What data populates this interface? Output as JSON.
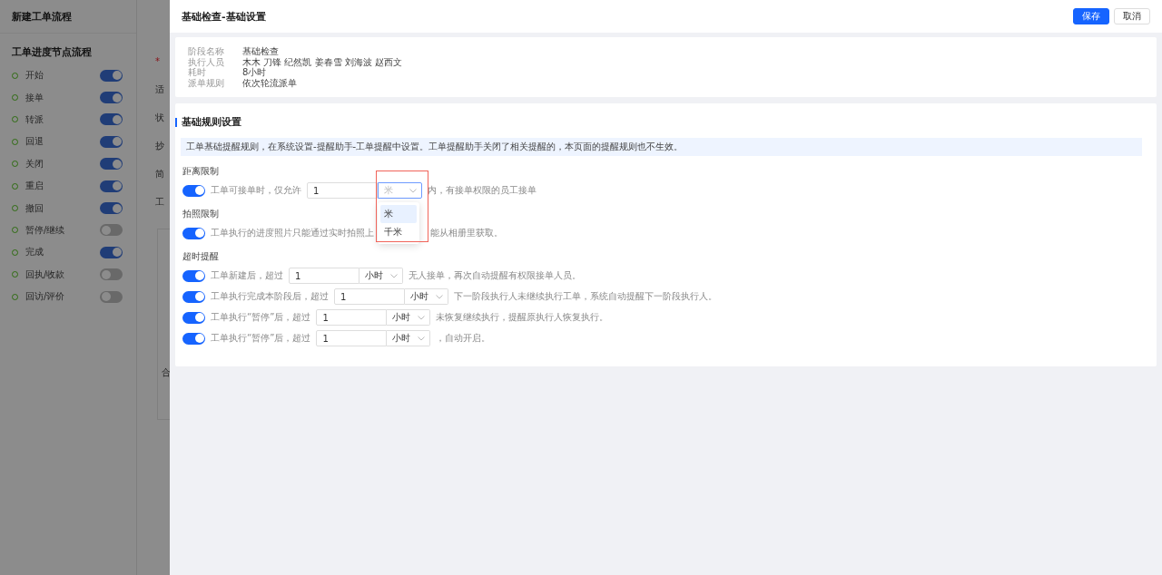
{
  "background_page": {
    "title": "新建工单流程",
    "section_title": "工单进度节点流程",
    "nodes": [
      {
        "label": "开始",
        "on": true
      },
      {
        "label": "接单",
        "on": true
      },
      {
        "label": "转派",
        "on": true
      },
      {
        "label": "回退",
        "on": true
      },
      {
        "label": "关闭",
        "on": true
      },
      {
        "label": "重启",
        "on": true
      },
      {
        "label": "撤回",
        "on": true
      },
      {
        "label": "暂停/继续",
        "on": false
      },
      {
        "label": "完成",
        "on": true
      },
      {
        "label": "回执/收款",
        "on": false
      },
      {
        "label": "回访/评价",
        "on": false
      }
    ],
    "form_fields": [
      {
        "label": "*",
        "kind": "required_mark"
      },
      {
        "label": "适",
        "kind": "label"
      },
      {
        "label": "状",
        "kind": "label"
      },
      {
        "label": "抄",
        "kind": "label"
      },
      {
        "label": "简",
        "kind": "label"
      },
      {
        "label": "工",
        "kind": "label"
      }
    ],
    "table_cell": "合"
  },
  "drawer": {
    "title": "基础检查-基础设置",
    "buttons": [
      {
        "label": "保存",
        "kind": "primary"
      },
      {
        "label": "取消",
        "kind": "default"
      }
    ],
    "info": [
      {
        "key": "阶段名称",
        "value": "基础检查"
      },
      {
        "key": "执行人员",
        "value": "木木 刀锋 纪然凯 姜春雪 刘海波 赵西文"
      },
      {
        "key": "耗时",
        "value": "8小时"
      },
      {
        "key": "派单规则",
        "value": "依次轮流派单"
      }
    ],
    "rules_card": {
      "title": "基础规则设置",
      "notice": "工单基础提醒规则，在系统设置-提醒助手-工单提醒中设置。工单提醒助手关闭了相关提醒的，本页面的提醒规则也不生效。",
      "groups": [
        {
          "heading": "距离限制",
          "rules": [
            {
              "kind": "select",
              "on": true,
              "prefix": "工单可接单时，仅允许",
              "value": "1",
              "unit_placeholder": "米",
              "focused": true,
              "suffix": "内，有接单权限的员工接单",
              "dropdown": {
                "highlighted": true,
                "options": [
                  {
                    "label": "米",
                    "selected": true
                  },
                  {
                    "label": "千米",
                    "selected": false
                  }
                ]
              }
            }
          ]
        },
        {
          "heading": "拍照限制",
          "rules": [
            {
              "kind": "text",
              "on": true,
              "text": "工单执行的进度照片只能通过实时拍照上",
              "text_after": "能从相册里获取。"
            }
          ]
        },
        {
          "heading": "超时提醒",
          "rules": [
            {
              "kind": "select",
              "on": true,
              "prefix": "工单新建后，超过",
              "value": "1",
              "unit_value": "小时",
              "focused": false,
              "suffix": "无人接单，再次自动提醒有权限接单人员。"
            },
            {
              "kind": "select",
              "on": true,
              "prefix": "工单执行完成本阶段后，超过",
              "value": "1",
              "unit_value": "小时",
              "focused": false,
              "suffix": "下一阶段执行人未继续执行工单，系统自动提醒下一阶段执行人。"
            },
            {
              "kind": "select",
              "on": true,
              "prefix": "工单执行“暂停”后，超过",
              "value": "1",
              "unit_value": "小时",
              "focused": false,
              "suffix": "未恢复继续执行，提醒原执行人恢复执行。"
            },
            {
              "kind": "select",
              "on": true,
              "prefix": "工单执行“暂停”后，超过",
              "value": "1",
              "unit_value": "小时",
              "focused": false,
              "suffix": "，自动开启。"
            }
          ]
        }
      ]
    }
  }
}
